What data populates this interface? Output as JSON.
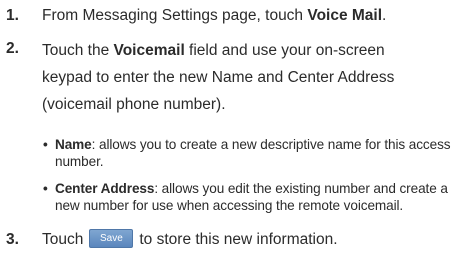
{
  "steps": [
    {
      "number": "1.",
      "text_before": "From Messaging Settings page, touch ",
      "bold": "Voice Mail",
      "text_after": "."
    },
    {
      "number": "2.",
      "text_before": "Touch the ",
      "bold": "Voicemail",
      "line1_after": " field and use your on-screen",
      "line2": "keypad to enter the new Name and Center Address",
      "line3": "(voicemail phone number)."
    },
    {
      "number": "3.",
      "text_before": "Touch",
      "button_label": "Save",
      "text_after": "to store this new information."
    }
  ],
  "bullets": [
    {
      "symbol": "•",
      "bold": "Name",
      "line1": ": allows you to create a new descriptive name for this access",
      "line2": "number."
    },
    {
      "symbol": "•",
      "bold": "Center Address",
      "line1": ": allows you edit the existing number and create a",
      "line2": "new number for use when accessing the remote voicemail."
    }
  ]
}
